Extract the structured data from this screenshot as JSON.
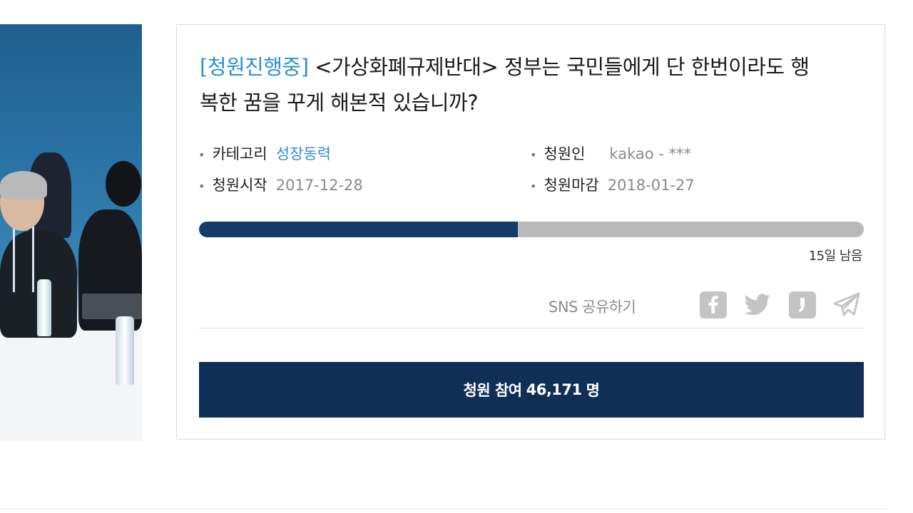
{
  "petition": {
    "status": "[청원진행중]",
    "title": "<가상화폐규제반대> 정부는 국민들에게 단 한번이라도 행복한 꿈을 꾸게 해본적 있습니까?",
    "category_label": "카테고리",
    "category_value": "성장동력",
    "petitioner_label": "청원인",
    "petitioner_value": "kakao - ***",
    "start_label": "청원시작",
    "start_value": "2017-12-28",
    "end_label": "청원마감",
    "end_value": "2018-01-27",
    "progress_fraction": 0.48,
    "remaining": "15일 남음",
    "share_label": "SNS 공유하기",
    "share_icons": [
      "facebook-icon",
      "twitter-icon",
      "kakaostory-icon",
      "telegram-icon"
    ],
    "join_label": "청원 참여",
    "participants": "46,171",
    "unit": "명"
  },
  "colors": {
    "accent": "#2b8fd6",
    "navy": "#0f2f57",
    "progress_fill": "#143c6a",
    "progress_track": "#b9b9b9",
    "icon_gray": "#c4c4c4"
  }
}
